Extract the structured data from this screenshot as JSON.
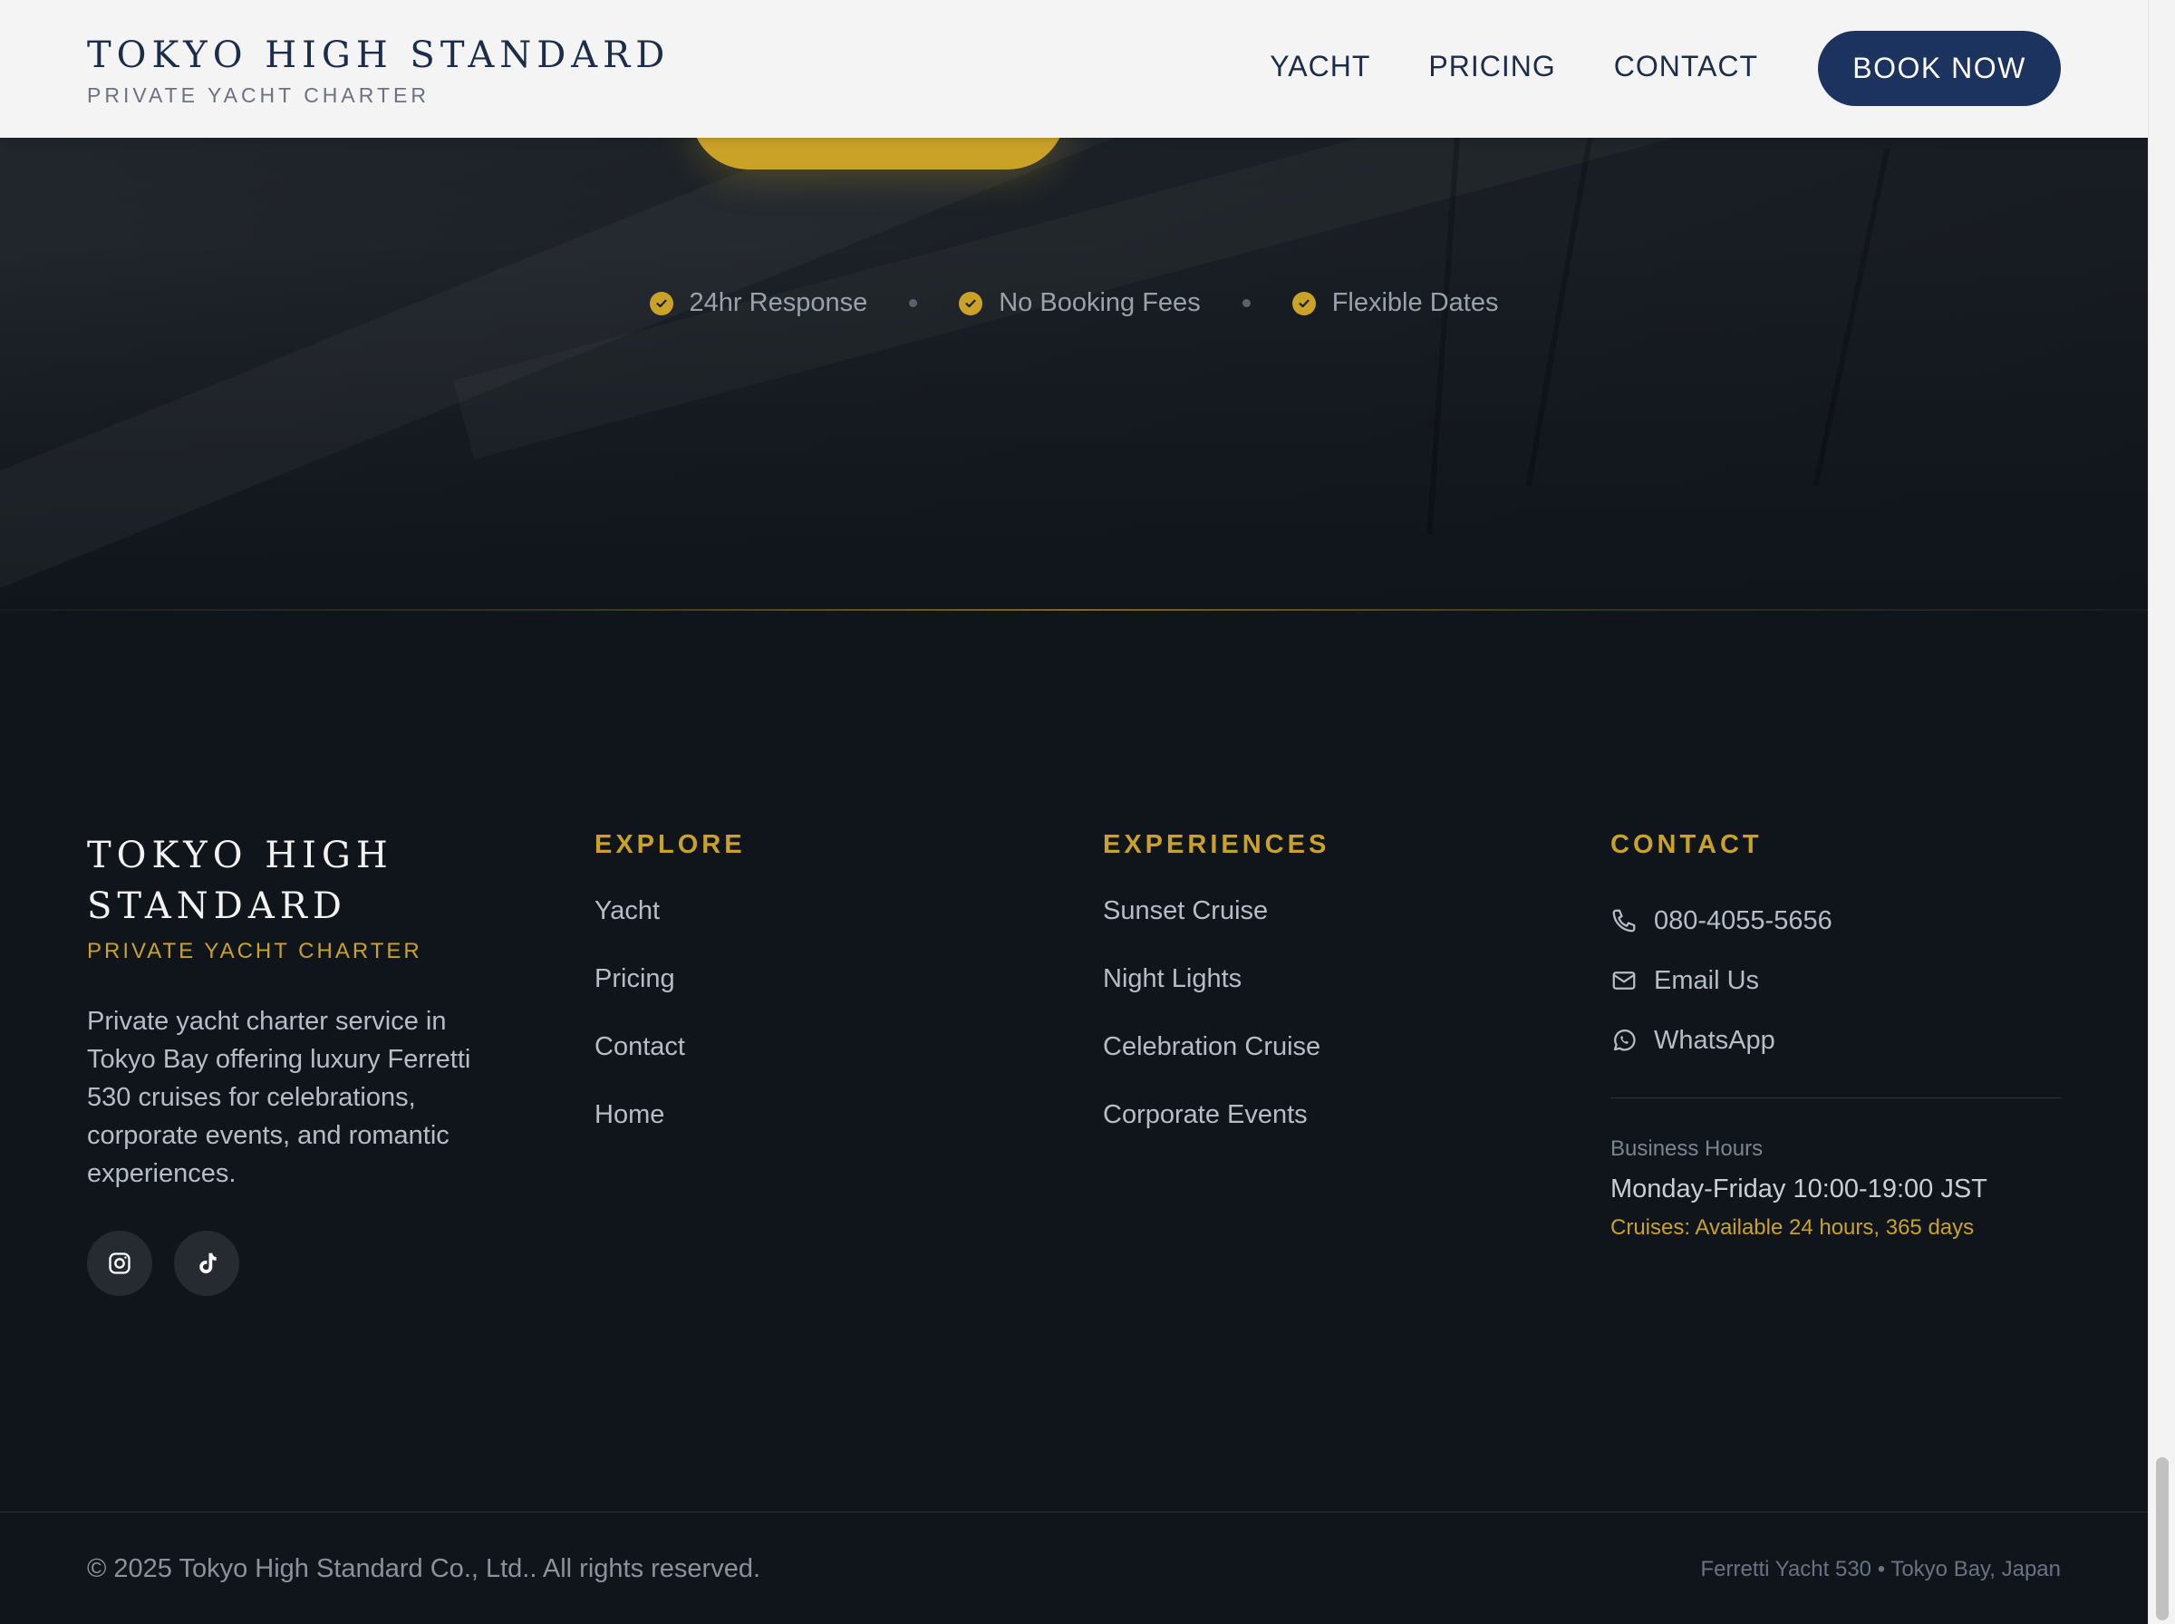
{
  "header": {
    "brand_name": "TOKYO HIGH STANDARD",
    "brand_tag": "PRIVATE YACHT CHARTER",
    "nav": [
      "YACHT",
      "PRICING",
      "CONTACT"
    ],
    "book_label": "BOOK NOW"
  },
  "trust": {
    "items": [
      "24hr Response",
      "No Booking Fees",
      "Flexible Dates"
    ],
    "icon": "check-circle-icon"
  },
  "footer": {
    "brand": {
      "name_line1": "TOKYO HIGH",
      "name_line2": "STANDARD",
      "tag": "PRIVATE YACHT CHARTER",
      "description": "Private yacht charter service in Tokyo Bay offering luxury Ferretti 530 cruises for celebrations, corporate events, and romantic experiences.",
      "socials": [
        "instagram-icon",
        "tiktok-icon"
      ]
    },
    "explore": {
      "heading": "EXPLORE",
      "links": [
        "Yacht",
        "Pricing",
        "Contact",
        "Home"
      ]
    },
    "experiences": {
      "heading": "EXPERIENCES",
      "links": [
        "Sunset Cruise",
        "Night Lights",
        "Celebration Cruise",
        "Corporate Events"
      ]
    },
    "contact": {
      "heading": "CONTACT",
      "phone": "080-4055-5656",
      "email": "Email Us",
      "whatsapp": "WhatsApp",
      "hours_label": "Business Hours",
      "hours_value": "Monday-Friday 10:00-19:00 JST",
      "hours_note": "Cruises: Available 24 hours, 365 days"
    }
  },
  "bottom": {
    "copyright": "© 2025 Tokyo High Standard Co., Ltd.. All rights reserved.",
    "location": "Ferretti Yacht 530 • Tokyo Bay, Japan"
  },
  "colors": {
    "accent_gold": "#c9a227",
    "navy": "#1c3360",
    "footer_bg": "#0f151b"
  }
}
